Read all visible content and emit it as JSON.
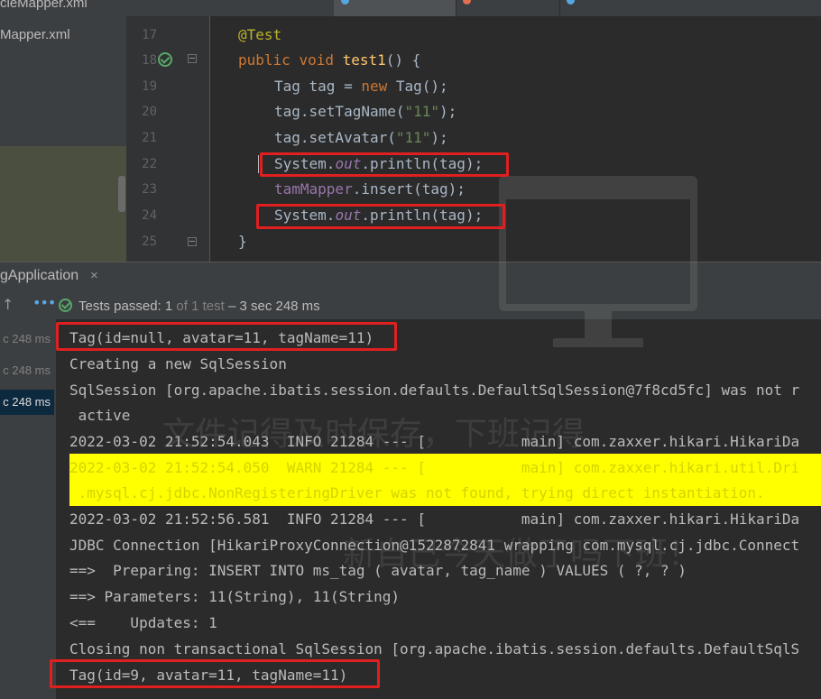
{
  "project": {
    "files": [
      "cleMapper.xml",
      "Mapper.xml"
    ]
  },
  "editor": {
    "line_numbers": [
      "17",
      "18",
      "19",
      "20",
      "21",
      "22",
      "23",
      "24",
      "25"
    ],
    "lines": [
      {
        "parts": [
          {
            "t": "@Test",
            "c": "anno"
          }
        ]
      },
      {
        "parts": [
          {
            "t": "public ",
            "c": "kw"
          },
          {
            "t": "void ",
            "c": "kw"
          },
          {
            "t": "test1",
            "c": "fn"
          },
          {
            "t": "() {",
            "c": ""
          }
        ]
      },
      {
        "parts": [
          {
            "t": "Tag tag = ",
            "c": ""
          },
          {
            "t": "new ",
            "c": "kw"
          },
          {
            "t": "Tag();",
            "c": ""
          }
        ]
      },
      {
        "parts": [
          {
            "t": "tag.setTagName(",
            "c": ""
          },
          {
            "t": "\"11\"",
            "c": "str"
          },
          {
            "t": ");",
            "c": ""
          }
        ]
      },
      {
        "parts": [
          {
            "t": "tag.setAvatar(",
            "c": ""
          },
          {
            "t": "\"11\"",
            "c": "str"
          },
          {
            "t": ");",
            "c": ""
          }
        ]
      },
      {
        "parts": [
          {
            "t": "System.",
            "c": ""
          },
          {
            "t": "out",
            "c": "fld"
          },
          {
            "t": ".println(tag);",
            "c": ""
          }
        ]
      },
      {
        "parts": [
          {
            "t": "tamMapper",
            "c": "mapr"
          },
          {
            "t": ".insert(tag);",
            "c": ""
          }
        ]
      },
      {
        "parts": [
          {
            "t": "System.",
            "c": ""
          },
          {
            "t": "out",
            "c": "fld"
          },
          {
            "t": ".println(tag);",
            "c": ""
          }
        ]
      },
      {
        "parts": [
          {
            "t": "}",
            "c": ""
          }
        ]
      }
    ]
  },
  "run": {
    "title": "gApplication",
    "close": "×",
    "arrow": "↑",
    "dots": "•••",
    "tests_passed_label": "Tests passed:",
    "tests_passed_count": "1",
    "tests_passed_of": "of 1 test",
    "tests_passed_time": "– 3 sec 248 ms",
    "tree_items": [
      "c 248 ms",
      "c 248 ms",
      "c 248 ms"
    ]
  },
  "console": {
    "lines": [
      "Tag(id=null, avatar=11, tagName=11)",
      "Creating a new SqlSession",
      "SqlSession [org.apache.ibatis.session.defaults.DefaultSqlSession@7f8cd5fc] was not r",
      " active",
      "2022-03-02 21:52:54.043  INFO 21284 --- [           main] com.zaxxer.hikari.HikariDa",
      "2022-03-02 21:52:54.050  WARN 21284 --- [           main] com.zaxxer.hikari.util.Dri",
      " .mysql.cj.jdbc.NonRegisteringDriver was not found, trying direct instantiation.",
      "2022-03-02 21:52:56.581  INFO 21284 --- [           main] com.zaxxer.hikari.HikariDa",
      "JDBC Connection [HikariProxyConnection@1522872841 wrapping com.mysql.cj.jdbc.Connect",
      "==>  Preparing: INSERT INTO ms_tag ( avatar, tag_name ) VALUES ( ?, ? )",
      "==> Parameters: 11(String), 11(String)",
      "<==    Updates: 1",
      "Closing non transactional SqlSession [org.apache.ibatis.session.defaults.DefaultSqlS",
      "Tag(id=9, avatar=11, tagName=11)"
    ]
  },
  "watermark": {
    "line1": "文件记得及时保存，下班记得",
    "line2": "新自己今天做了吗下班！"
  },
  "colors": {
    "highlight": "#e02020",
    "warn_bg": "#ffff00",
    "pass": "#59a869"
  }
}
